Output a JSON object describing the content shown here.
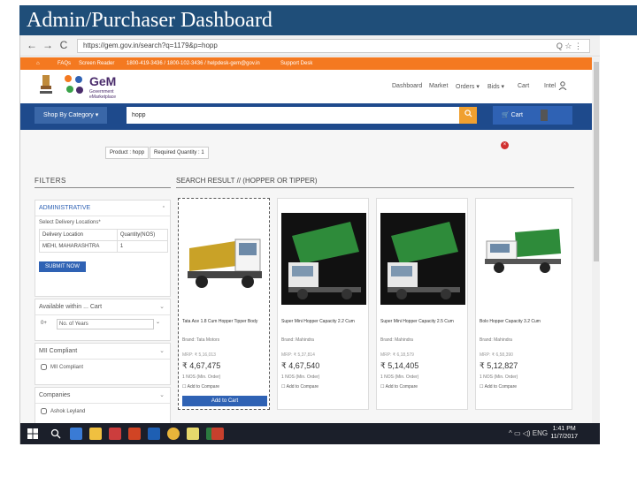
{
  "slide": {
    "title": "Admin/Purchaser Dashboard"
  },
  "browser": {
    "back": "←",
    "forward": "→",
    "reload": "C",
    "url": "https://gem.gov.in/search?q=1179&p=hopp",
    "icons": "Q ☆ ⋮"
  },
  "topbar": {
    "home": "⌂",
    "faq": "FAQs",
    "screen_reader": "Screen Reader",
    "helpline": "1800-419-3436 / 1800-102-3436 / helpdesk-gem@gov.in",
    "support": "Support Desk"
  },
  "header": {
    "logo_main": "GeM",
    "logo_sub1": "Government",
    "logo_sub2": "eMarketplace",
    "nav": [
      "Dashboard",
      "Market",
      "Orders ▾",
      "Bids ▾",
      "Cart",
      "Intel"
    ]
  },
  "search": {
    "category_label": "Shop By Category ▾",
    "query": "hopp",
    "cart_label": "Cart"
  },
  "chips": {
    "product": "Product : hopp",
    "quantity": "Required Quantity : 1"
  },
  "filters": {
    "title": "FILTERS",
    "results_title": "SEARCH RESULT // (HOPPER OR TIPPER)",
    "administrative": "ADMINISTRATIVE",
    "select_delivery": "Select Delivery Locations*",
    "col_location": "Delivery Location",
    "col_quantity": "Quantity(NOS)",
    "row_location": "MEHI, MAHARASHTRA",
    "row_quantity": "1",
    "submit": "SUBMIT NOW",
    "warranty_label": "Available within ... Cart",
    "warranty_value": "No. of Years",
    "warranty_prefix": "0+",
    "mii_label": "MII Compliant",
    "mii_check": "MII Compliant",
    "companies_label": "Companies",
    "companies_check": "Ashok Leyland"
  },
  "products": [
    {
      "title": "Tata Ace 1.8 Cum Hopper Tipper Body",
      "brand": "Brand: Tata Motors",
      "mrp": "MRP: ₹ 5,16,013",
      "price": "₹ 4,67,475",
      "min": "1 NOS (Min. Order)",
      "compare": "Add to Compare",
      "add": "Add to Cart"
    },
    {
      "title": "Super Mini Hopper Capacity 2.2 Cum",
      "brand": "Brand: Mahindra",
      "mrp": "MRP: ₹ 5,37,814",
      "price": "₹ 4,67,540",
      "min": "1 NOS (Min. Order)",
      "compare": "Add to Compare"
    },
    {
      "title": "Super Mini Hopper Capacity 2.5 Cum",
      "brand": "Brand: Mahindra",
      "mrp": "MRP: ₹ 6,18,579",
      "price": "₹ 5,14,405",
      "min": "1 NOS (Min. Order)",
      "compare": "Add to Compare"
    },
    {
      "title": "Bolo Hopper Capacity 3.2 Cum",
      "brand": "Brand: Mahindra",
      "mrp": "MRP: ₹ 6,58,390",
      "price": "₹ 5,12,827",
      "min": "1 NOS (Min. Order)",
      "compare": "Add to Compare"
    }
  ],
  "taskbar": {
    "time": "1:41 PM",
    "date": "11/7/2017",
    "tray": "^ ▭ ◁) ENG"
  },
  "colors": {
    "slide_title_bg": "#1f4e79",
    "gem_orange": "#f47920",
    "gem_blue": "#1e4a8c",
    "button_blue": "#2f62b4",
    "search_orange": "#f0a030"
  }
}
